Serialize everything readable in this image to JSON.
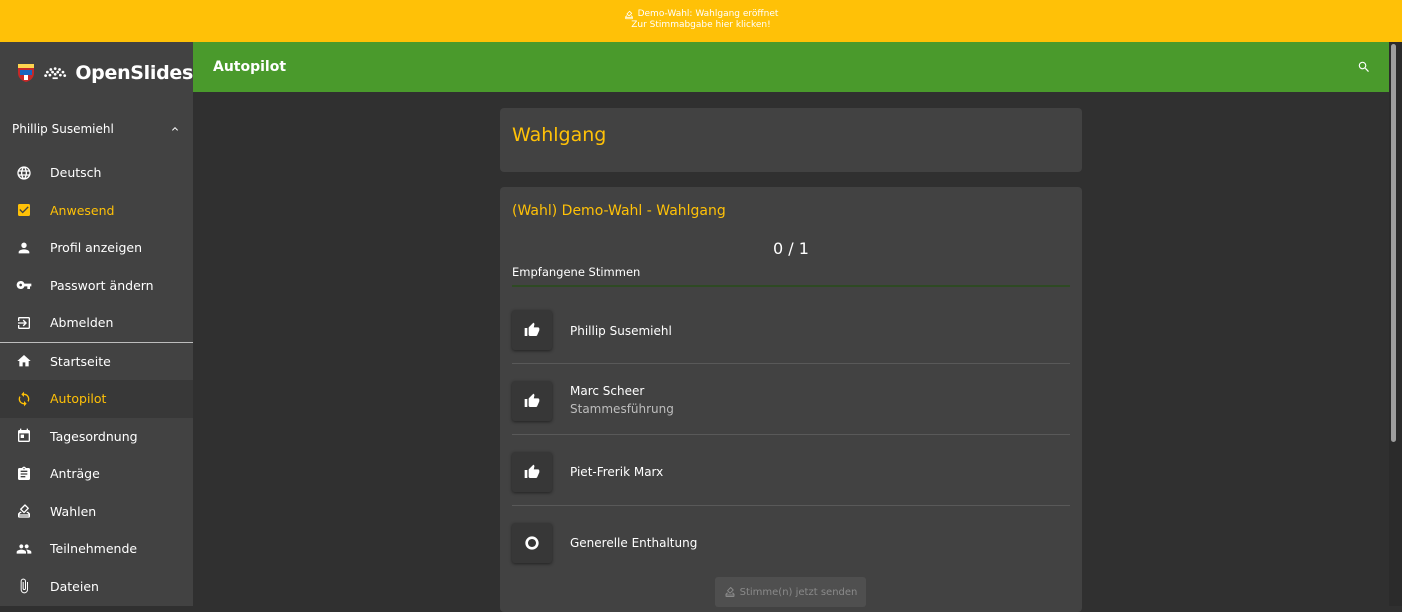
{
  "banner": {
    "line1": "Demo-Wahl: Wahlgang eröffnet",
    "line2": "Zur Stimmabgabe hier klicken!",
    "color": "#ffc107"
  },
  "brand": {
    "name": "OpenSlides"
  },
  "user": {
    "name": "Phillip Susemiehl"
  },
  "user_menu": [
    {
      "label": "Deutsch",
      "icon": "globe-icon"
    },
    {
      "label": "Anwesend",
      "icon": "checkbox-checked-icon"
    },
    {
      "label": "Profil anzeigen",
      "icon": "person-icon"
    },
    {
      "label": "Passwort ändern",
      "icon": "key-icon"
    },
    {
      "label": "Abmelden",
      "icon": "logout-icon"
    }
  ],
  "nav": [
    {
      "label": "Startseite",
      "icon": "home-icon"
    },
    {
      "label": "Autopilot",
      "icon": "sync-icon"
    },
    {
      "label": "Tagesordnung",
      "icon": "calendar-icon"
    },
    {
      "label": "Anträge",
      "icon": "clipboard-icon"
    },
    {
      "label": "Wahlen",
      "icon": "ballot-icon"
    },
    {
      "label": "Teilnehmende",
      "icon": "people-icon"
    },
    {
      "label": "Dateien",
      "icon": "attachment-icon"
    }
  ],
  "topbar": {
    "title": "Autopilot",
    "accent": "#4a9a2c"
  },
  "section": {
    "title": "Wahlgang"
  },
  "poll": {
    "title": "(Wahl) Demo-Wahl - Wahlgang",
    "count": "0 / 1",
    "votes_label": "Empfangene Stimmen",
    "options": [
      {
        "name": "Phillip Susemiehl",
        "sub": "",
        "icon": "thumb-up-icon"
      },
      {
        "name": "Marc Scheer",
        "sub": "Stammesführung",
        "icon": "thumb-up-icon"
      },
      {
        "name": "Piet-Frerik Marx",
        "sub": "",
        "icon": "thumb-up-icon"
      },
      {
        "name": "Generelle Enthaltung",
        "sub": "",
        "icon": "circle-icon"
      }
    ],
    "send_label": "Stimme(n) jetzt senden"
  }
}
